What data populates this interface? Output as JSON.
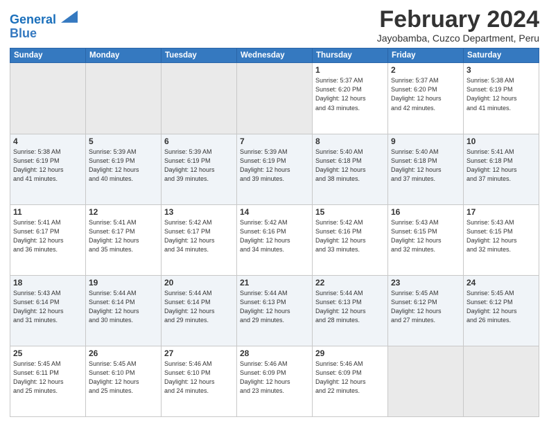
{
  "header": {
    "logo_line1": "General",
    "logo_line2": "Blue",
    "month_title": "February 2024",
    "location": "Jayobamba, Cuzco Department, Peru"
  },
  "weekdays": [
    "Sunday",
    "Monday",
    "Tuesday",
    "Wednesday",
    "Thursday",
    "Friday",
    "Saturday"
  ],
  "weeks": [
    [
      {
        "day": "",
        "info": ""
      },
      {
        "day": "",
        "info": ""
      },
      {
        "day": "",
        "info": ""
      },
      {
        "day": "",
        "info": ""
      },
      {
        "day": "1",
        "info": "Sunrise: 5:37 AM\nSunset: 6:20 PM\nDaylight: 12 hours\nand 43 minutes."
      },
      {
        "day": "2",
        "info": "Sunrise: 5:37 AM\nSunset: 6:20 PM\nDaylight: 12 hours\nand 42 minutes."
      },
      {
        "day": "3",
        "info": "Sunrise: 5:38 AM\nSunset: 6:19 PM\nDaylight: 12 hours\nand 41 minutes."
      }
    ],
    [
      {
        "day": "4",
        "info": "Sunrise: 5:38 AM\nSunset: 6:19 PM\nDaylight: 12 hours\nand 41 minutes."
      },
      {
        "day": "5",
        "info": "Sunrise: 5:39 AM\nSunset: 6:19 PM\nDaylight: 12 hours\nand 40 minutes."
      },
      {
        "day": "6",
        "info": "Sunrise: 5:39 AM\nSunset: 6:19 PM\nDaylight: 12 hours\nand 39 minutes."
      },
      {
        "day": "7",
        "info": "Sunrise: 5:39 AM\nSunset: 6:19 PM\nDaylight: 12 hours\nand 39 minutes."
      },
      {
        "day": "8",
        "info": "Sunrise: 5:40 AM\nSunset: 6:18 PM\nDaylight: 12 hours\nand 38 minutes."
      },
      {
        "day": "9",
        "info": "Sunrise: 5:40 AM\nSunset: 6:18 PM\nDaylight: 12 hours\nand 37 minutes."
      },
      {
        "day": "10",
        "info": "Sunrise: 5:41 AM\nSunset: 6:18 PM\nDaylight: 12 hours\nand 37 minutes."
      }
    ],
    [
      {
        "day": "11",
        "info": "Sunrise: 5:41 AM\nSunset: 6:17 PM\nDaylight: 12 hours\nand 36 minutes."
      },
      {
        "day": "12",
        "info": "Sunrise: 5:41 AM\nSunset: 6:17 PM\nDaylight: 12 hours\nand 35 minutes."
      },
      {
        "day": "13",
        "info": "Sunrise: 5:42 AM\nSunset: 6:17 PM\nDaylight: 12 hours\nand 34 minutes."
      },
      {
        "day": "14",
        "info": "Sunrise: 5:42 AM\nSunset: 6:16 PM\nDaylight: 12 hours\nand 34 minutes."
      },
      {
        "day": "15",
        "info": "Sunrise: 5:42 AM\nSunset: 6:16 PM\nDaylight: 12 hours\nand 33 minutes."
      },
      {
        "day": "16",
        "info": "Sunrise: 5:43 AM\nSunset: 6:15 PM\nDaylight: 12 hours\nand 32 minutes."
      },
      {
        "day": "17",
        "info": "Sunrise: 5:43 AM\nSunset: 6:15 PM\nDaylight: 12 hours\nand 32 minutes."
      }
    ],
    [
      {
        "day": "18",
        "info": "Sunrise: 5:43 AM\nSunset: 6:14 PM\nDaylight: 12 hours\nand 31 minutes."
      },
      {
        "day": "19",
        "info": "Sunrise: 5:44 AM\nSunset: 6:14 PM\nDaylight: 12 hours\nand 30 minutes."
      },
      {
        "day": "20",
        "info": "Sunrise: 5:44 AM\nSunset: 6:14 PM\nDaylight: 12 hours\nand 29 minutes."
      },
      {
        "day": "21",
        "info": "Sunrise: 5:44 AM\nSunset: 6:13 PM\nDaylight: 12 hours\nand 29 minutes."
      },
      {
        "day": "22",
        "info": "Sunrise: 5:44 AM\nSunset: 6:13 PM\nDaylight: 12 hours\nand 28 minutes."
      },
      {
        "day": "23",
        "info": "Sunrise: 5:45 AM\nSunset: 6:12 PM\nDaylight: 12 hours\nand 27 minutes."
      },
      {
        "day": "24",
        "info": "Sunrise: 5:45 AM\nSunset: 6:12 PM\nDaylight: 12 hours\nand 26 minutes."
      }
    ],
    [
      {
        "day": "25",
        "info": "Sunrise: 5:45 AM\nSunset: 6:11 PM\nDaylight: 12 hours\nand 25 minutes."
      },
      {
        "day": "26",
        "info": "Sunrise: 5:45 AM\nSunset: 6:10 PM\nDaylight: 12 hours\nand 25 minutes."
      },
      {
        "day": "27",
        "info": "Sunrise: 5:46 AM\nSunset: 6:10 PM\nDaylight: 12 hours\nand 24 minutes."
      },
      {
        "day": "28",
        "info": "Sunrise: 5:46 AM\nSunset: 6:09 PM\nDaylight: 12 hours\nand 23 minutes."
      },
      {
        "day": "29",
        "info": "Sunrise: 5:46 AM\nSunset: 6:09 PM\nDaylight: 12 hours\nand 22 minutes."
      },
      {
        "day": "",
        "info": ""
      },
      {
        "day": "",
        "info": ""
      }
    ]
  ]
}
